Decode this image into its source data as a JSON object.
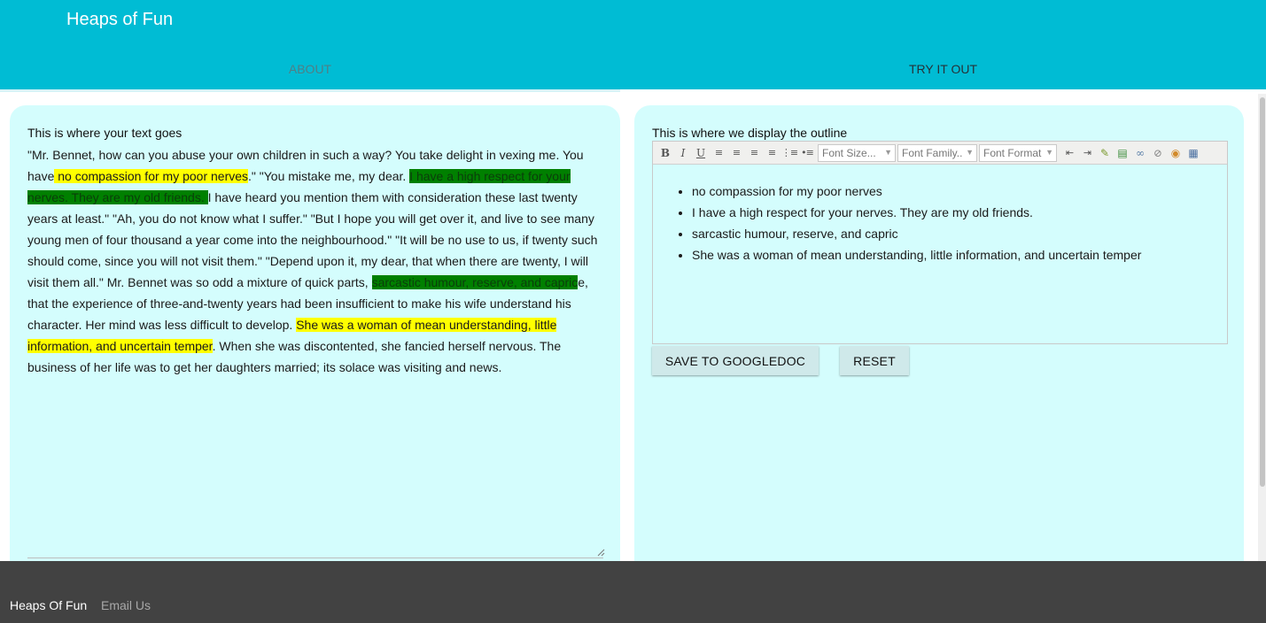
{
  "header": {
    "title": "Heaps of Fun",
    "tabs": [
      {
        "label": "ABOUT",
        "active": false
      },
      {
        "label": "TRY IT OUT",
        "active": true
      }
    ]
  },
  "left_panel": {
    "label": "This is where your text goes",
    "segments": [
      {
        "text": "\"Mr. Bennet, how can you abuse your own children in such a way? You take delight in vexing me. You have",
        "hl": ""
      },
      {
        "text": " no compassion for my poor nerves",
        "hl": "yellow"
      },
      {
        "text": ".\" \"You mistake me, my dear. ",
        "hl": ""
      },
      {
        "text": "I have a high respect for your nerves. They are my old friends. ",
        "hl": "green"
      },
      {
        "text": "I have heard you mention them with consideration these last twenty years at least.\" \"Ah, you do not know what I suffer.\" \"But I hope you will get over it, and live to see many young men of four thousand a year come into the neighbourhood.\" \"It will be no use to us, if twenty such should come, since you will not visit them.\" \"Depend upon it, my dear, that when there are twenty, I will visit them all.\" Mr. Bennet was so odd a mixture of quick parts, ",
        "hl": ""
      },
      {
        "text": "sarcastic humour, reserve, and capric",
        "hl": "green"
      },
      {
        "text": "e, that the experience of three-and-twenty years had been insufficient to make his wife understand his character. Her mind was less difficult to develop. ",
        "hl": ""
      },
      {
        "text": "She was a woman of mean understanding, little information, and uncertain temper",
        "hl": "yellow"
      },
      {
        "text": ". When she was discontented, she fancied herself nervous. The business of her life was to get her daughters married; its solace was visiting and news.",
        "hl": ""
      }
    ]
  },
  "right_panel": {
    "label": "This is where we display the outline",
    "toolbar": {
      "font_size": "Font Size...",
      "font_family": "Font Family..",
      "font_format": "Font Format"
    },
    "outline": [
      "no compassion for my poor nerves",
      "I have a high respect for your nerves. They are my old friends.",
      "sarcastic humour, reserve, and capric",
      "She was a woman of mean understanding, little information, and uncertain temper"
    ],
    "buttons": {
      "save": "SAVE TO GOOGLEDOC",
      "reset": "RESET"
    }
  },
  "footer": {
    "brand": "Heaps Of Fun",
    "link": "Email Us"
  },
  "colors": {
    "header": "#00bcd4",
    "panel": "#d4fdfd",
    "highlight_yellow": "#ffff00",
    "highlight_green": "#008000",
    "footer": "#424242"
  }
}
